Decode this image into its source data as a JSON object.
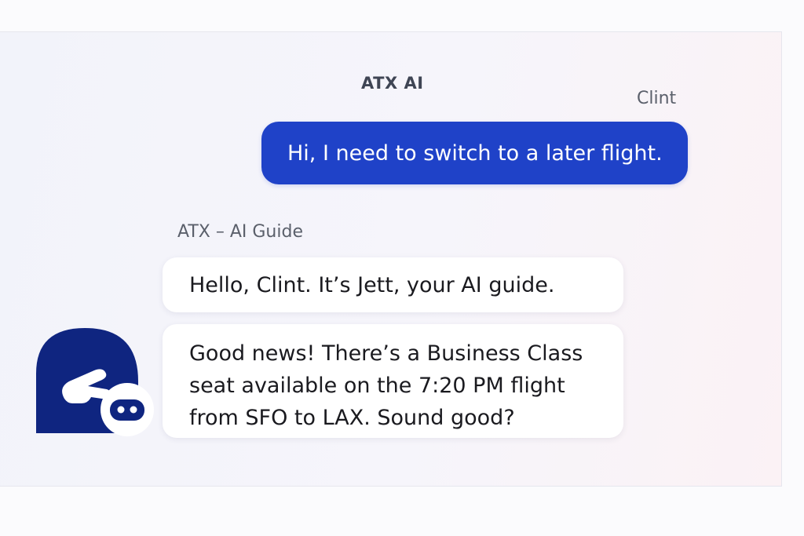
{
  "header": {
    "title": "ATX AI"
  },
  "messages": {
    "user": {
      "sender": "Clint",
      "text": "Hi, I need to switch to a later flight."
    },
    "ai": {
      "sender": "ATX – AI Guide",
      "greeting": "Hello, Clint. It’s Jett, your AI guide.",
      "reply_lines": [
        "Good news! There’s a Business Class",
        "seat available on the 7:20 PM flight",
        "from SFO to LAX. Sound good?"
      ]
    }
  },
  "avatar": {
    "icon": "jett-bot-avatar-icon",
    "colors": {
      "primary": "#0f2580",
      "accent": "#ffffff"
    }
  },
  "colors": {
    "user_bubble": "#1f42c8",
    "ai_bubble": "#ffffff",
    "text_dark": "#1a1a1f",
    "label": "#5b606b"
  }
}
